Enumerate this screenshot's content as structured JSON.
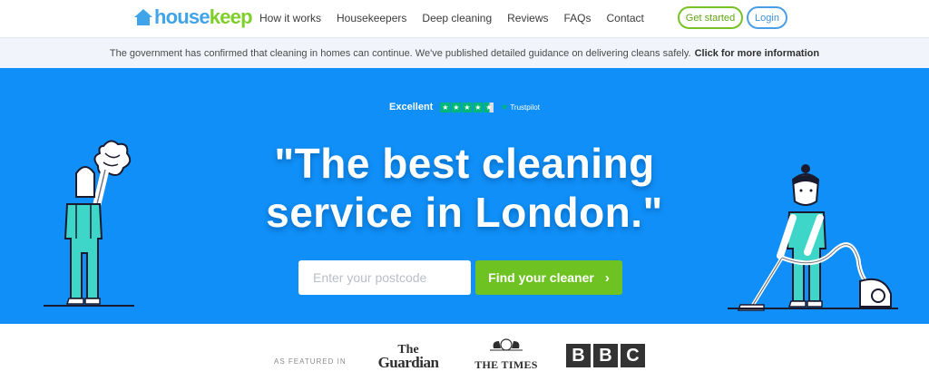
{
  "header": {
    "logo_part1": "house",
    "logo_part2": "keep",
    "nav": [
      {
        "label": "How it works"
      },
      {
        "label": "Housekeepers"
      },
      {
        "label": "Deep cleaning"
      },
      {
        "label": "Reviews"
      },
      {
        "label": "FAQs"
      },
      {
        "label": "Contact"
      }
    ],
    "get_started": "Get started",
    "login": "Login"
  },
  "notice": {
    "text": "The government has confirmed that cleaning in homes can continue. We've published detailed guidance on delivering cleans safely.",
    "link": "Click for more information"
  },
  "hero": {
    "rating_label": "Excellent",
    "rating_stars": 4.5,
    "trustpilot": "Trustpilot",
    "headline_line1": "\"The best cleaning",
    "headline_line2": "service in London.\"",
    "postcode_placeholder": "Enter your postcode",
    "find_button": "Find your cleaner"
  },
  "featured": {
    "label": "AS FEATURED IN",
    "guardian_line1": "The",
    "guardian_line2": "Guardian",
    "times": "THE TIMES",
    "bbc": [
      "B",
      "B",
      "C"
    ]
  },
  "colors": {
    "hero_bg": "#0f8ff7",
    "brand_blue": "#3fa4ea",
    "brand_green": "#7fcf2b",
    "cta_green": "#6ec322",
    "trustpilot_green": "#00b67a",
    "figure_teal": "#3ed6c9"
  }
}
